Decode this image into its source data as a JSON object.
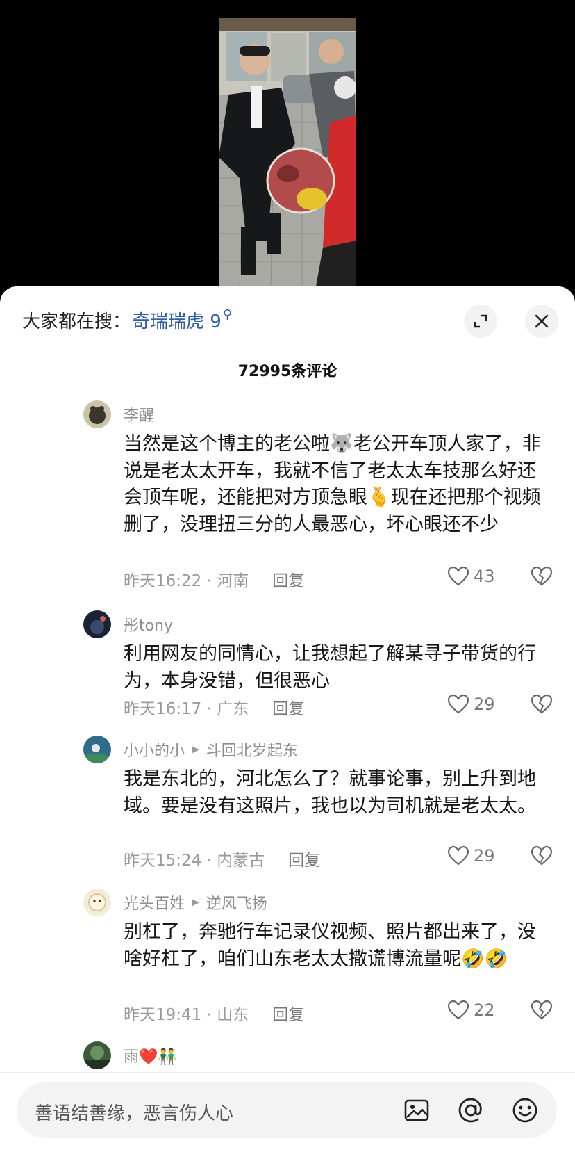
{
  "search": {
    "prefix": "大家都在搜：",
    "keyword": "奇瑞瑞虎 9"
  },
  "comments_count": "72995条评论",
  "comments": [
    {
      "user": "李醒",
      "text": "当然是这个博主的老公啦🐺老公开车顶人家了，非说是老太太开车，我就不信了老太太车技那么好还会顶车呢，还能把对方顶急眼🫰现在还把那个视频删了，没理扭三分的人最恶心，坏心眼还不少",
      "time_location": "昨天16:22 · 河南",
      "reply_label": "回复",
      "likes": "43"
    },
    {
      "user": "彤tony",
      "text": "利用网友的同情心，让我想起了解某寻子带货的行为，本身没错，但很恶心",
      "time_location": "昨天16:17 · 广东",
      "reply_label": "回复",
      "likes": "29"
    },
    {
      "user": "小小的小",
      "reply_to": "斗回北岁起东",
      "text": "我是东北的，河北怎么了？就事论事，别上升到地域。要是没有这照片，我也以为司机就是老太太。",
      "time_location": "昨天15:24 · 内蒙古",
      "reply_label": "回复",
      "likes": "29"
    },
    {
      "user": "光头百姓",
      "reply_to": "逆风飞扬",
      "text": "别杠了，奔驰行车记录仪视频、照片都出来了，没啥好杠了，咱们山东老太太撒谎博流量呢🤣🤣",
      "time_location": "昨天19:41 · 山东",
      "reply_label": "回复",
      "likes": "22"
    },
    {
      "user": "雨❤️👬"
    }
  ],
  "input": {
    "placeholder": "善语结善缘，恶言伤人心"
  },
  "icons": {
    "expand": "expand-icon",
    "close": "close-icon",
    "like": "heart-icon",
    "dislike": "broken-heart-icon",
    "image": "image-icon",
    "mention": "at-icon",
    "emoji": "smiley-icon"
  }
}
